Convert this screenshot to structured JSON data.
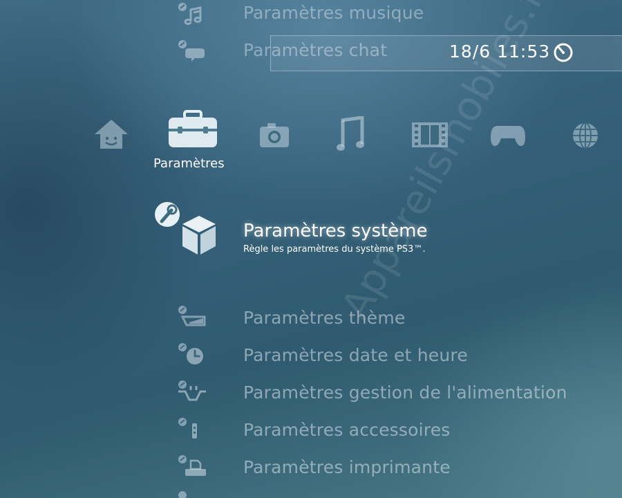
{
  "clock": {
    "datetime": "18/6 11:53",
    "icon": "clock-icon"
  },
  "top_items": [
    {
      "label": "Paramètres musique",
      "icon": "music-settings-icon"
    },
    {
      "label": "Paramètres chat",
      "icon": "chat-settings-icon"
    }
  ],
  "categories": {
    "items": [
      {
        "name": "home",
        "icon": "home-icon"
      },
      {
        "name": "settings",
        "icon": "toolbox-icon",
        "label": "Paramètres",
        "selected": true
      },
      {
        "name": "photo",
        "icon": "camera-icon"
      },
      {
        "name": "music",
        "icon": "music-note-icon"
      },
      {
        "name": "video",
        "icon": "film-icon"
      },
      {
        "name": "game",
        "icon": "gamepad-icon"
      },
      {
        "name": "network",
        "icon": "globe-icon"
      }
    ],
    "selected_label": "Paramètres"
  },
  "selected_item": {
    "title": "Paramètres système",
    "description": "Règle les paramètres du système PS3™.",
    "icon": "system-settings-cube-icon"
  },
  "items": [
    {
      "label": "Paramètres thème",
      "icon": "theme-settings-icon"
    },
    {
      "label": "Paramètres date et heure",
      "icon": "date-time-settings-icon"
    },
    {
      "label": "Paramètres gestion de l'alimentation",
      "icon": "power-settings-icon"
    },
    {
      "label": "Paramètres accessoires",
      "icon": "accessory-settings-icon"
    },
    {
      "label": "Paramètres imprimante",
      "icon": "printer-settings-icon"
    }
  ],
  "watermark": "Appareilsmobiles.fr",
  "colors": {
    "background": "#36617a",
    "text_active": "#ffffff",
    "text_inactive": "#e1ecf2",
    "icon": "#bcd0da"
  }
}
